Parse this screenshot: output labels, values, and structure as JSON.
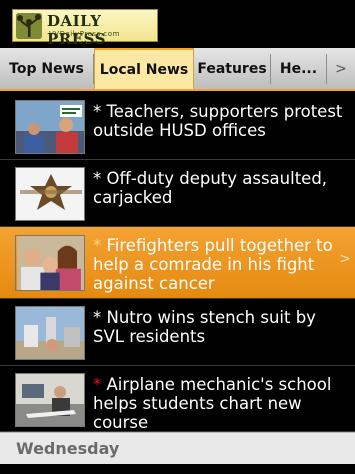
{
  "header": {
    "brand": "DAILY PRESS",
    "site": "VVDailyPress.com",
    "logo_icon": "joshua-tree-icon"
  },
  "tabs": [
    {
      "label": "Top News",
      "active": false
    },
    {
      "label": "Local News",
      "active": true
    },
    {
      "label": "Features",
      "active": false
    },
    {
      "label": "He...",
      "active": false
    },
    {
      "label": ">",
      "active": false
    }
  ],
  "articles": [
    {
      "star": "*",
      "title": "Teachers, supporters protest outside HUSD offices",
      "selected": false,
      "star_color": "#ffffff"
    },
    {
      "star": "*",
      "title": "Off-duty deputy assaulted, carjacked",
      "selected": false,
      "star_color": "#ffffff"
    },
    {
      "star": "*",
      "title": "Firefighters pull together to help a comrade in his fight against cancer",
      "selected": true,
      "star_color": "#ffffff"
    },
    {
      "star": "*",
      "title": "Nutro wins stench suit by SVL residents",
      "selected": false,
      "star_color": "#ffffff"
    },
    {
      "star": "*",
      "title": "Airplane mechanic's school helps students chart new course",
      "selected": false,
      "star_color": "#e11111"
    }
  ],
  "selected_chevron": ">",
  "day_header": "Wednesday",
  "colors": {
    "accent": "#f2a424",
    "selected_row": "#e58a10",
    "tab_active": "#fce8a2"
  }
}
